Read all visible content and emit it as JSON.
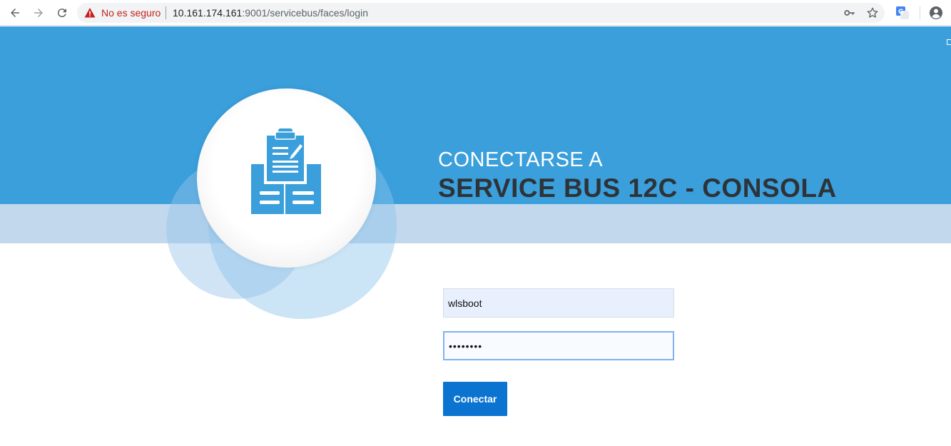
{
  "browser": {
    "security_warning": "No es seguro",
    "url_host": "10.161.174.161",
    "url_rest": ":9001/servicebus/faces/login",
    "icons": [
      "back-icon",
      "forward-icon",
      "reload-icon",
      "warning-icon",
      "key-icon",
      "star-icon",
      "translate-icon",
      "account-icon"
    ]
  },
  "page": {
    "title_line1": "CONECTARSE A",
    "title_line2": "SERVICE BUS 12C - CONSOLA",
    "username_value": "wlsboot",
    "password_value": "••••••••",
    "submit_label": "Conectar",
    "colors": {
      "banner": "#3a9fdb",
      "band": "#c2d9ed",
      "button": "#0b74d1",
      "title_dark": "#2e3338"
    },
    "logo_icon": "clipboard-documents-icon"
  }
}
